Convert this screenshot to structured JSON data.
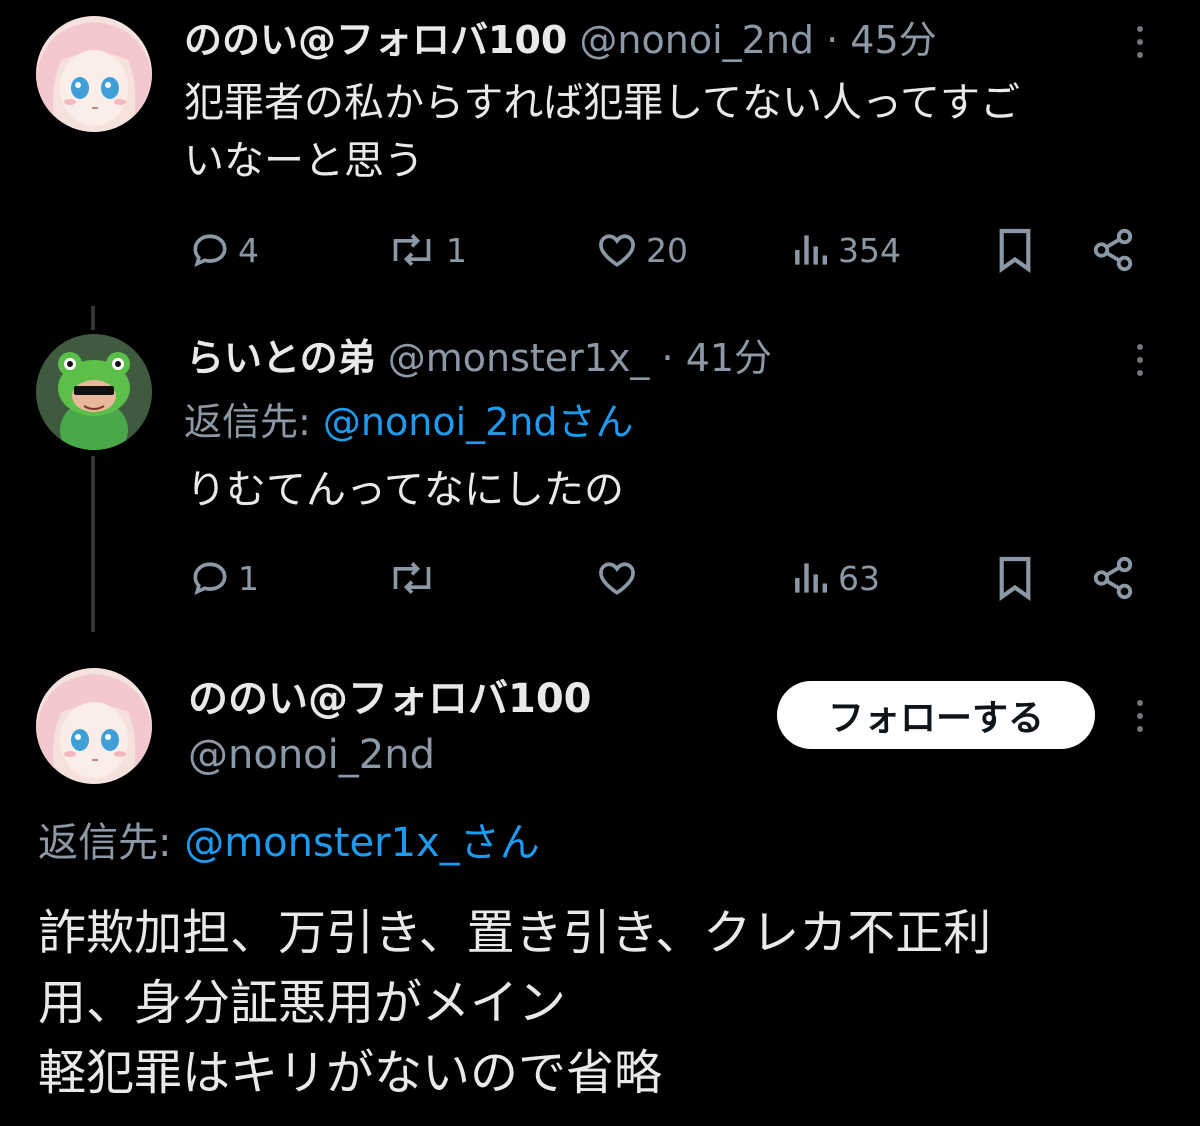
{
  "colors": {
    "background": "#000000",
    "text": "#e7e9ea",
    "muted": "#8b98a5",
    "link": "#1d9bf0",
    "icon": "#8b98a5",
    "thread_line": "#333639"
  },
  "tweet1": {
    "name": "ののい@フォロバ100",
    "handle": "@nonoi_2nd",
    "time": "· 45分",
    "text_line1": "犯罪者の私からすれば犯罪してない人ってすご",
    "text_line2": "いなーと思う",
    "replies": "4",
    "retweets": "1",
    "likes": "20",
    "views": "354"
  },
  "tweet2": {
    "name": "らいとの弟",
    "handle": "@monster1x_",
    "time": "· 41分",
    "reply_prefix": "返信先:",
    "reply_to": "@nonoi_2ndさん",
    "text": "りむてんってなにしたの",
    "replies": "1",
    "views": "63"
  },
  "tweet3": {
    "name": "ののい@フォロバ100",
    "handle": "@nonoi_2nd",
    "follow_label": "フォローする",
    "reply_prefix": "返信先:",
    "reply_to": "@monster1x_さん",
    "text_line1": "詐欺加担、万引き、置き引き、クレカ不正利",
    "text_line2": "用、身分証悪用がメイン",
    "text_line3": "軽犯罪はキリがないので省略"
  },
  "icons": [
    "reply-icon",
    "retweet-icon",
    "like-icon",
    "views-icon",
    "bookmark-icon",
    "share-icon",
    "more-icon"
  ]
}
